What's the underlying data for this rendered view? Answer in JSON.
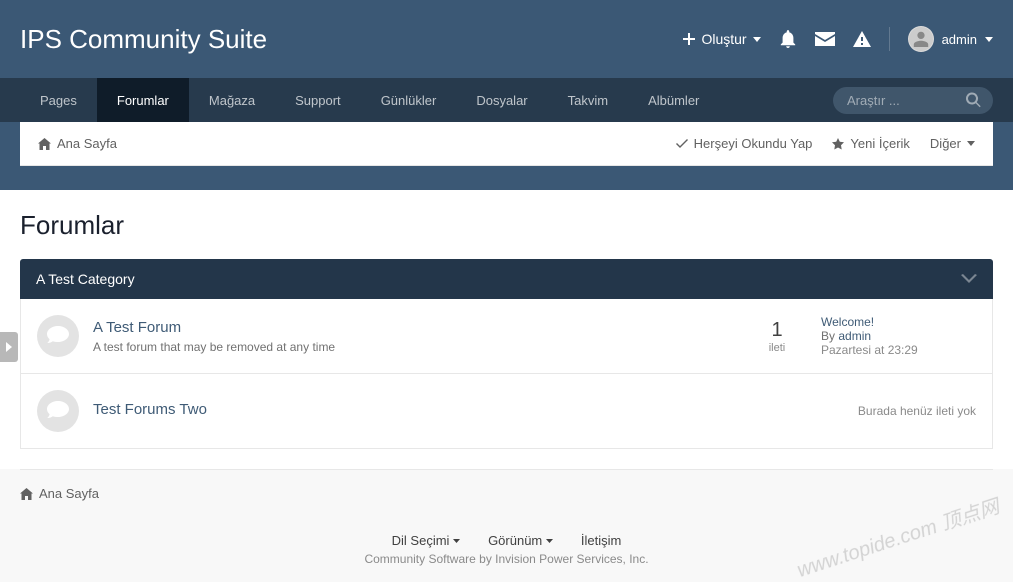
{
  "site": {
    "title": "IPS Community Suite"
  },
  "header": {
    "create_label": "Oluştur",
    "username": "admin"
  },
  "nav": {
    "items": [
      {
        "label": "Pages",
        "active": false
      },
      {
        "label": "Forumlar",
        "active": true
      },
      {
        "label": "Mağaza",
        "active": false
      },
      {
        "label": "Support",
        "active": false
      },
      {
        "label": "Günlükler",
        "active": false
      },
      {
        "label": "Dosyalar",
        "active": false
      },
      {
        "label": "Takvim",
        "active": false
      },
      {
        "label": "Albümler",
        "active": false
      }
    ],
    "search_placeholder": "Araştır ..."
  },
  "breadcrumb": {
    "home": "Ana Sayfa",
    "actions": {
      "mark_read": "Herşeyi Okundu Yap",
      "new_content": "Yeni İçerik",
      "more": "Diğer"
    }
  },
  "page": {
    "title": "Forumlar"
  },
  "category": {
    "name": "A Test Category",
    "forums": [
      {
        "name": "A Test Forum",
        "description": "A test forum that may be removed at any time",
        "posts_count": "1",
        "posts_label": "ileti",
        "last_post": {
          "title": "Welcome!",
          "by_prefix": "By ",
          "by_user": "admin",
          "time": "Pazartesi at 23:29"
        }
      },
      {
        "name": "Test Forums Two",
        "description": "",
        "no_posts_text": "Burada henüz ileti yok"
      }
    ]
  },
  "footer": {
    "home": "Ana Sayfa",
    "lang": "Dil Seçimi",
    "view": "Görünüm",
    "contact": "İletişim",
    "copyright": "Community Software by Invision Power Services, Inc."
  },
  "watermark": "www.topide.com 顶点网"
}
